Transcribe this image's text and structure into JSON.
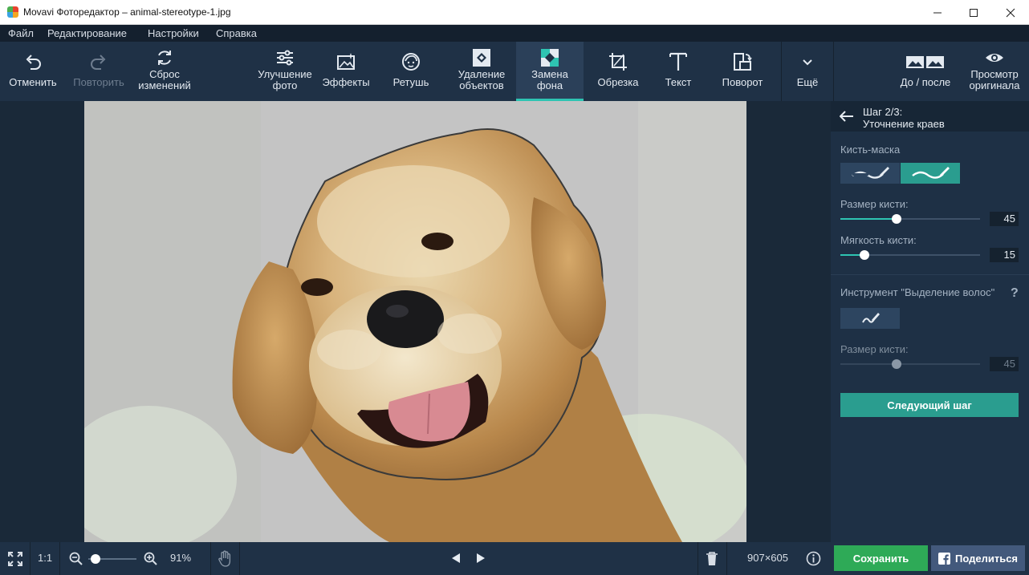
{
  "window": {
    "title": "Movavi Фоторедактор – animal-stereotype-1.jpg",
    "app_icon": "movavi-logo-icon",
    "controls": [
      "minimize-icon",
      "maximize-icon",
      "close-icon"
    ]
  },
  "menu": {
    "items": [
      "Файл",
      "Редактирование",
      "Настройки",
      "Справка"
    ]
  },
  "toolbar": {
    "undo": {
      "label": "Отменить",
      "icon": "undo-icon"
    },
    "redo": {
      "label": "Повторить",
      "icon": "redo-icon",
      "disabled": true
    },
    "reset": {
      "line1": "Сброс",
      "line2": "изменений",
      "icon": "reset-icon"
    },
    "enhance": {
      "line1": "Улучшение",
      "line2": "фото",
      "icon": "sliders-icon"
    },
    "effects": {
      "label": "Эффекты",
      "icon": "effects-icon"
    },
    "retouch": {
      "label": "Ретушь",
      "icon": "face-icon"
    },
    "remove_objects": {
      "line1": "Удаление",
      "line2": "объектов",
      "icon": "remove-objects-icon"
    },
    "replace_bg": {
      "line1": "Замена",
      "line2": "фона",
      "icon": "replace-background-icon",
      "active": true
    },
    "crop": {
      "label": "Обрезка",
      "icon": "crop-icon"
    },
    "text": {
      "label": "Текст",
      "icon": "text-icon"
    },
    "rotate": {
      "label": "Поворот",
      "icon": "rotate-icon"
    },
    "more": {
      "label": "Ещё",
      "icon": "chevron-down-icon"
    },
    "before_after": {
      "label": "До / после",
      "icon": "before-after-icon"
    },
    "preview_original": {
      "line1": "Просмотр",
      "line2": "оригинала",
      "icon": "eye-icon"
    }
  },
  "panel": {
    "back_icon": "arrow-left-icon",
    "step_line1": "Шаг 2/3:",
    "step_line2": "Уточнение краев",
    "brush_mask_label": "Кисть-маска",
    "brush_modes": [
      {
        "icon": "brush-erase-icon",
        "selected": false
      },
      {
        "icon": "brush-keep-icon",
        "selected": true
      }
    ],
    "brush_size_label": "Размер кисти:",
    "brush_size_value": "45",
    "brush_size_fraction": 0.4,
    "brush_softness_label": "Мягкость кисти:",
    "brush_softness_value": "15",
    "brush_softness_fraction": 0.17,
    "hair_tool_label": "Инструмент \"Выделение волос\"",
    "help_icon": "question-icon",
    "hair_tool_icon": "hair-brush-icon",
    "hair_brush_size_label": "Размер кисти:",
    "hair_brush_size_value": "45",
    "hair_brush_size_fraction": 0.4,
    "next_step": "Следующий шаг"
  },
  "bottom": {
    "fullscreen_icon": "fullscreen-icon",
    "actual_size": "1:1",
    "zoom_out_icon": "zoom-out-icon",
    "zoom_in_icon": "zoom-in-icon",
    "zoom_fraction": 0.15,
    "zoom": "91%",
    "hand_icon": "hand-icon",
    "prev_icon": "prev-icon",
    "next_icon": "next-icon",
    "trash_icon": "trash-icon",
    "dimensions": "907×605",
    "info_icon": "info-icon",
    "save": "Сохранить",
    "share": "Поделиться",
    "share_icon": "facebook-icon"
  },
  "colors": {
    "accent": "#2ec4b2",
    "toolbar_bg": "#1f3146",
    "save_green": "#2eaa57",
    "share_blue": "#43597c",
    "next_teal": "#2a9d8f"
  }
}
